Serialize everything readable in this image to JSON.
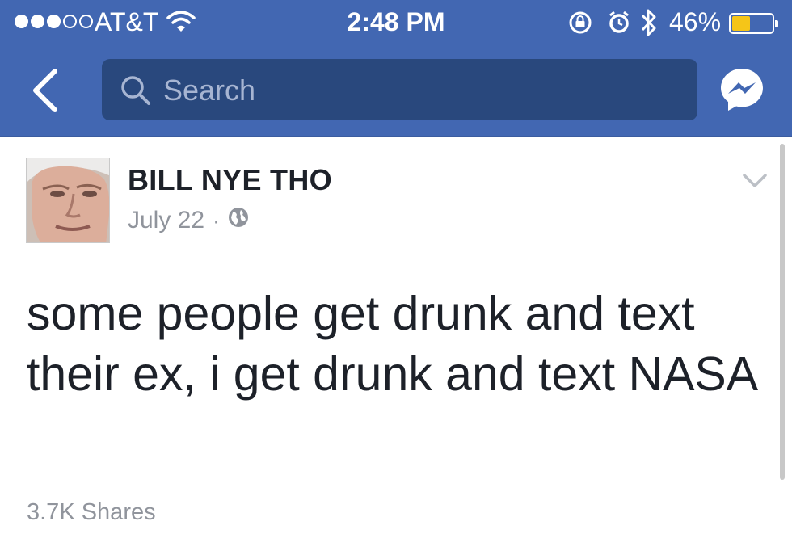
{
  "status_bar": {
    "carrier": "AT&T",
    "time": "2:48 PM",
    "battery_percent": "46%",
    "battery_level": 0.46,
    "signal_bars_filled": 3,
    "signal_bars_total": 5,
    "icons": [
      "wifi-icon",
      "rotation-lock-icon",
      "alarm-icon",
      "bluetooth-icon",
      "battery-icon"
    ]
  },
  "nav": {
    "back_icon": "chevron-left-icon",
    "search_placeholder": "Search",
    "messenger_icon": "messenger-icon"
  },
  "post": {
    "author": "BILL NYE THO",
    "date": "July 22",
    "separator": "·",
    "privacy_icon": "globe-icon",
    "menu_icon": "chevron-down-icon",
    "text": "some people get drunk and text their ex, i get drunk and text NASA",
    "shares": "3.7K Shares"
  },
  "colors": {
    "brand_blue": "#4267b2",
    "search_bg": "#29487d",
    "battery_yellow": "#f5c518"
  }
}
